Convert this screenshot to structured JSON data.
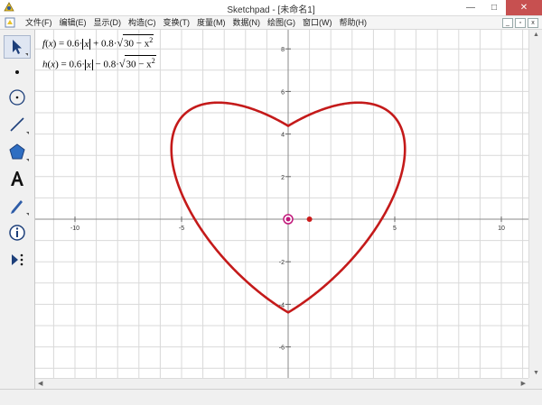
{
  "window": {
    "title": "Sketchpad - [未命名1]",
    "minimize_glyph": "—",
    "maximize_glyph": "□",
    "close_glyph": "✕"
  },
  "menu": {
    "items": [
      "文件(F)",
      "编辑(E)",
      "显示(D)",
      "构造(C)",
      "变换(T)",
      "度量(M)",
      "数据(N)",
      "绘图(G)",
      "窗口(W)",
      "帮助(H)"
    ],
    "mdi": [
      "_",
      "▫",
      "x"
    ]
  },
  "toolbox": {
    "tools": [
      "arrow-select-tool",
      "point-tool",
      "compass-tool",
      "straightedge-tool",
      "polygon-tool",
      "text-tool",
      "marker-tool",
      "information-tool",
      "custom-tool"
    ]
  },
  "formulas": {
    "f": {
      "name": "f",
      "var": "x",
      "eq": " = 0.6·",
      "abs": "x",
      "op": " + 0.8·",
      "radicand": "30 − x",
      "exp": "2"
    },
    "h": {
      "name": "h",
      "var": "x",
      "eq": " = 0.6·",
      "abs": "x",
      "op": " − 0.8·",
      "radicand": "30 − x",
      "exp": "2"
    }
  },
  "chart_data": {
    "type": "line",
    "x_ticks": [
      -10,
      -5,
      5,
      10
    ],
    "y_ticks": [
      -6,
      -4,
      -2,
      2,
      4,
      6,
      8
    ],
    "xlim": [
      -11.5,
      11.5
    ],
    "ylim": [
      -7,
      8.5
    ],
    "grid": true,
    "curve_color": "#c41a1a",
    "origin_point_color": "#c0177a",
    "unit_point_color": "#cc1a1a",
    "series": [
      {
        "expr": "0.6*|x| + 0.8*sqrt(30 - x^2)",
        "domain": [
          -5.477,
          5.477
        ]
      },
      {
        "expr": "0.6*|x| - 0.8*sqrt(30 - x^2)",
        "domain": [
          -5.477,
          5.477
        ]
      }
    ],
    "points": [
      {
        "x": 0,
        "y": 0,
        "role": "origin"
      },
      {
        "x": 1,
        "y": 0,
        "role": "unit-point"
      }
    ]
  }
}
